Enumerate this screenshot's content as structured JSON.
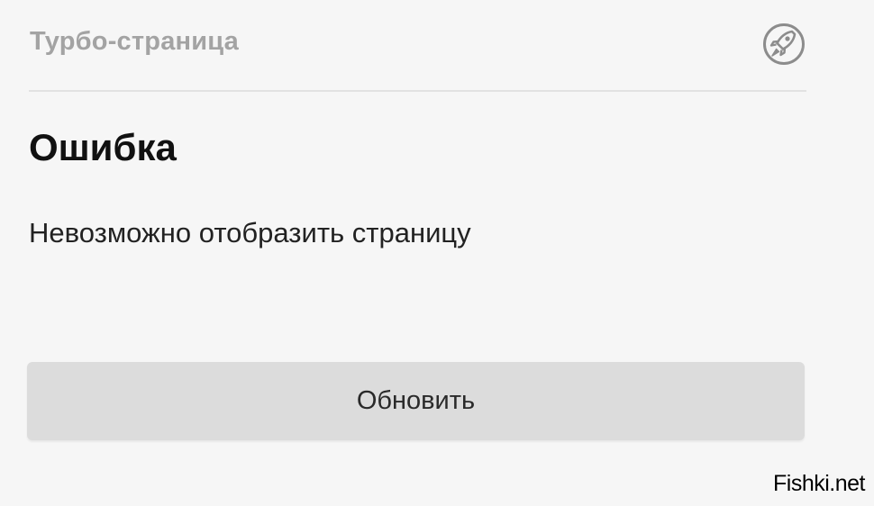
{
  "header": {
    "title": "Турбо-страница",
    "icon": "rocket-icon"
  },
  "error": {
    "title": "Ошибка",
    "message": "Невозможно отобразить страницу"
  },
  "actions": {
    "refresh_label": "Обновить"
  },
  "watermark": {
    "text": "Fishki.net"
  },
  "colors": {
    "background": "#f6f6f6",
    "header_text": "#a3a3a3",
    "button_bg": "#dcdcdc",
    "divider": "#e2e2e2"
  }
}
